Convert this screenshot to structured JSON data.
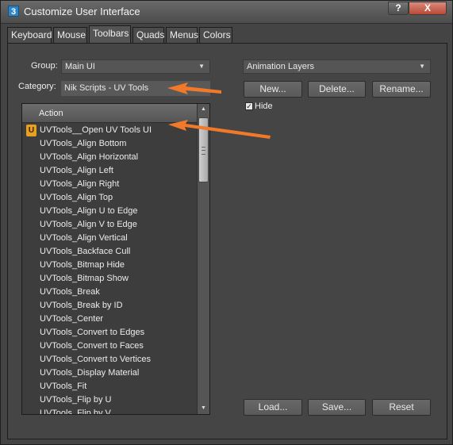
{
  "window": {
    "app_icon": "3",
    "title": "Customize User Interface",
    "help_label": "?",
    "close_label": "X"
  },
  "tabs": [
    "Keyboard",
    "Mouse",
    "Toolbars",
    "Quads",
    "Menus",
    "Colors"
  ],
  "active_tab": "Toolbars",
  "group": {
    "label": "Group:",
    "value": "Main UI"
  },
  "category": {
    "label": "Category:",
    "value": "Nik Scripts - UV Tools"
  },
  "action_list": {
    "header": "Action",
    "items": [
      "UVTools__Open UV Tools UI",
      "UVTools_Align Bottom",
      "UVTools_Align Horizontal",
      "UVTools_Align Left",
      "UVTools_Align Right",
      "UVTools_Align Top",
      "UVTools_Align U to Edge",
      "UVTools_Align V to Edge",
      "UVTools_Align Vertical",
      "UVTools_Backface Cull",
      "UVTools_Bitmap Hide",
      "UVTools_Bitmap Show",
      "UVTools_Break",
      "UVTools_Break by ID",
      "UVTools_Center",
      "UVTools_Convert to Edges",
      "UVTools_Convert to Faces",
      "UVTools_Convert to Vertices",
      "UVTools_Display Material",
      "UVTools_Fit",
      "UVTools_Flip by U",
      "UVTools_Flip by V"
    ]
  },
  "toolbar_select": {
    "value": "Animation Layers"
  },
  "buttons": {
    "new": "New...",
    "delete": "Delete...",
    "rename": "Rename...",
    "load": "Load...",
    "save": "Save...",
    "reset": "Reset"
  },
  "hide_checkbox": {
    "label": "Hide",
    "checked": true
  },
  "colors": {
    "annotation_arrow": "#f07a2a",
    "u_icon": "#e8a020"
  }
}
